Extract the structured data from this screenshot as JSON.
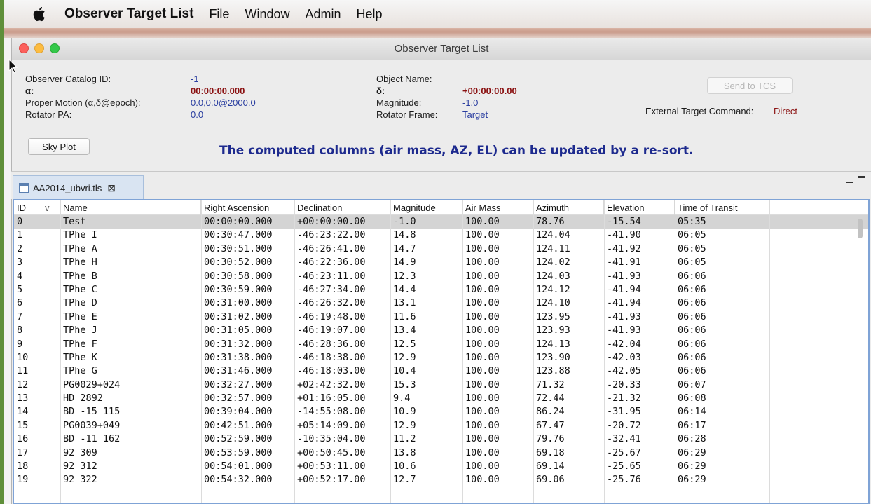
{
  "menubar": {
    "app_name": "Observer Target List",
    "items": [
      "File",
      "Window",
      "Admin",
      "Help"
    ]
  },
  "window": {
    "title": "Observer Target List"
  },
  "info": {
    "catalog_id_label": "Observer Catalog ID:",
    "catalog_id_value": "-1",
    "alpha_label": "α:",
    "alpha_value": "00:00:00.000",
    "proper_motion_label": "Proper Motion (α,δ@epoch):",
    "proper_motion_value": "0.0,0.0@2000.0",
    "rotator_pa_label": "Rotator PA:",
    "rotator_pa_value": "0.0",
    "object_name_label": "Object Name:",
    "object_name_value": "",
    "delta_label": "δ:",
    "delta_value": "+00:00:00.00",
    "magnitude_label": "Magnitude:",
    "magnitude_value": "-1.0",
    "rotator_frame_label": "Rotator Frame:",
    "rotator_frame_value": "Target",
    "send_tcs_label": "Send to TCS",
    "external_cmd_label": "External Target Command:",
    "external_cmd_value": "Direct",
    "sky_plot_label": "Sky Plot",
    "notice": "The computed columns (air mass, AZ, EL) can be updated by a re-sort."
  },
  "tab": {
    "label": "AA2014_ubvri.tls",
    "close_glyph": "⊠"
  },
  "table": {
    "columns": [
      "ID",
      "Name",
      "Right Ascension",
      "Declination",
      "Magnitude",
      "Air Mass",
      "Azimuth",
      "Elevation",
      "Time of Transit"
    ],
    "sort_indicator": "v",
    "rows": [
      [
        "0",
        "Test",
        "00:00:00.000",
        "+00:00:00.00",
        "-1.0",
        "100.00",
        "78.76",
        "-15.54",
        "05:35"
      ],
      [
        "1",
        "TPhe I",
        "00:30:47.000",
        "-46:23:22.00",
        "14.8",
        "100.00",
        "124.04",
        "-41.90",
        "06:05"
      ],
      [
        "2",
        "TPhe A",
        "00:30:51.000",
        "-46:26:41.00",
        "14.7",
        "100.00",
        "124.11",
        "-41.92",
        "06:05"
      ],
      [
        "3",
        "TPhe H",
        "00:30:52.000",
        "-46:22:36.00",
        "14.9",
        "100.00",
        "124.02",
        "-41.91",
        "06:05"
      ],
      [
        "4",
        "TPhe B",
        "00:30:58.000",
        "-46:23:11.00",
        "12.3",
        "100.00",
        "124.03",
        "-41.93",
        "06:06"
      ],
      [
        "5",
        "TPhe C",
        "00:30:59.000",
        "-46:27:34.00",
        "14.4",
        "100.00",
        "124.12",
        "-41.94",
        "06:06"
      ],
      [
        "6",
        "TPhe D",
        "00:31:00.000",
        "-46:26:32.00",
        "13.1",
        "100.00",
        "124.10",
        "-41.94",
        "06:06"
      ],
      [
        "7",
        "TPhe E",
        "00:31:02.000",
        "-46:19:48.00",
        "11.6",
        "100.00",
        "123.95",
        "-41.93",
        "06:06"
      ],
      [
        "8",
        "TPhe J",
        "00:31:05.000",
        "-46:19:07.00",
        "13.4",
        "100.00",
        "123.93",
        "-41.93",
        "06:06"
      ],
      [
        "9",
        "TPhe F",
        "00:31:32.000",
        "-46:28:36.00",
        "12.5",
        "100.00",
        "124.13",
        "-42.04",
        "06:06"
      ],
      [
        "10",
        "TPhe K",
        "00:31:38.000",
        "-46:18:38.00",
        "12.9",
        "100.00",
        "123.90",
        "-42.03",
        "06:06"
      ],
      [
        "11",
        "TPhe G",
        "00:31:46.000",
        "-46:18:03.00",
        "10.4",
        "100.00",
        "123.88",
        "-42.05",
        "06:06"
      ],
      [
        "12",
        "PG0029+024",
        "00:32:27.000",
        "+02:42:32.00",
        "15.3",
        "100.00",
        "71.32",
        "-20.33",
        "06:07"
      ],
      [
        "13",
        "HD 2892",
        "00:32:57.000",
        "+01:16:05.00",
        "9.4",
        "100.00",
        "72.44",
        "-21.32",
        "06:08"
      ],
      [
        "14",
        "BD -15 115",
        "00:39:04.000",
        "-14:55:08.00",
        "10.9",
        "100.00",
        "86.24",
        "-31.95",
        "06:14"
      ],
      [
        "15",
        "PG0039+049",
        "00:42:51.000",
        "+05:14:09.00",
        "12.9",
        "100.00",
        "67.47",
        "-20.72",
        "06:17"
      ],
      [
        "16",
        "BD -11 162",
        "00:52:59.000",
        "-10:35:04.00",
        "11.2",
        "100.00",
        "79.76",
        "-32.41",
        "06:28"
      ],
      [
        "17",
        "92 309",
        "00:53:59.000",
        "+00:50:45.00",
        "13.8",
        "100.00",
        "69.18",
        "-25.67",
        "06:29"
      ],
      [
        "18",
        "92 312",
        "00:54:01.000",
        "+00:53:11.00",
        "10.6",
        "100.00",
        "69.14",
        "-25.65",
        "06:29"
      ],
      [
        "19",
        "92 322",
        "00:54:32.000",
        "+00:52:17.00",
        "12.7",
        "100.00",
        "69.06",
        "-25.76",
        "06:29"
      ]
    ],
    "selected_row": 0
  },
  "colors": {
    "label_blue": "#2a3ea0",
    "value_red": "#8a1010",
    "notice_blue": "#1d2a8e",
    "selection": "#d4d4d4",
    "table_border": "#7fa3d6"
  }
}
